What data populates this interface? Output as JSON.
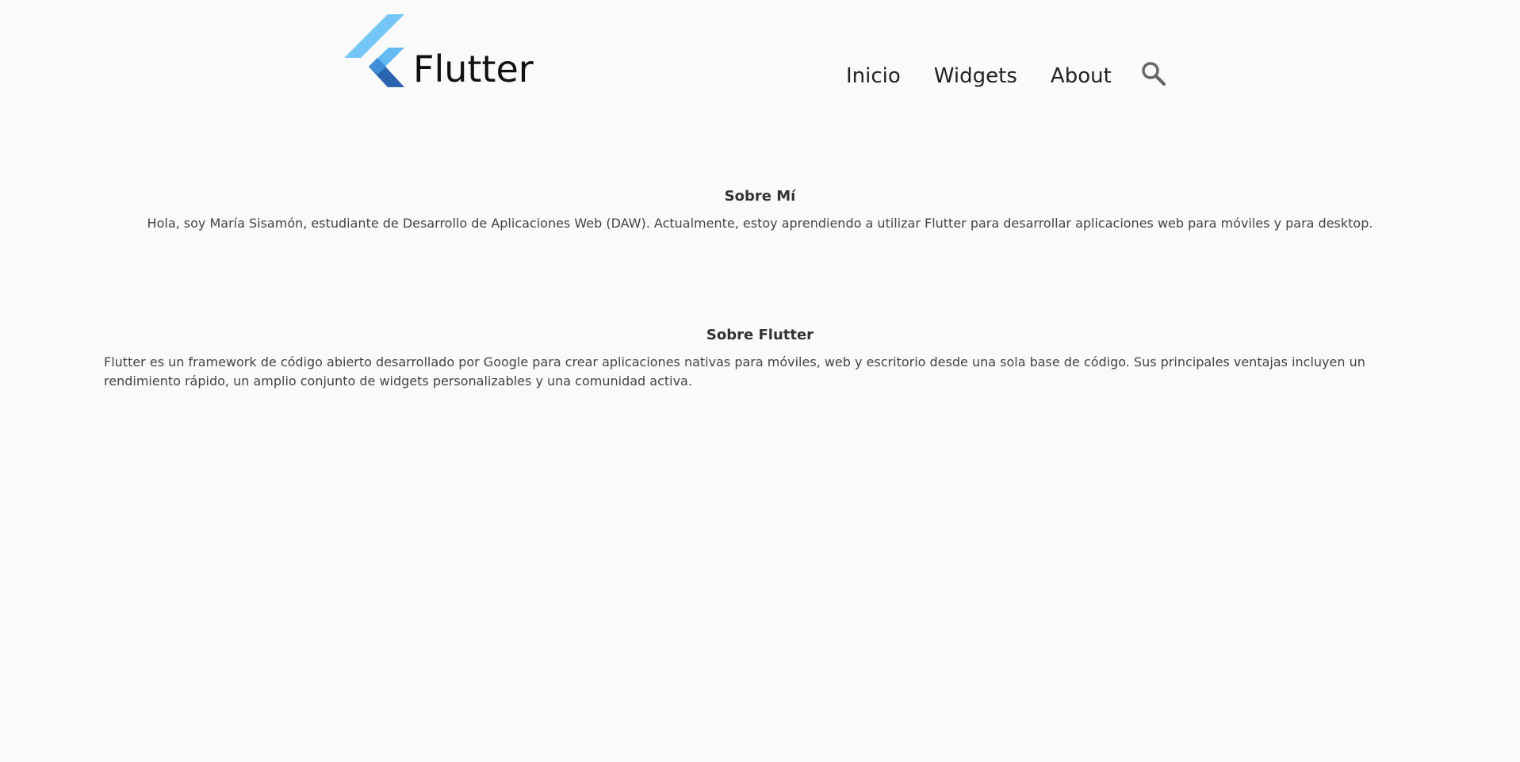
{
  "header": {
    "brand_name": "Flutter",
    "logo_icon": "flutter-logo-icon",
    "nav": {
      "items": [
        {
          "label": "Inicio"
        },
        {
          "label": "Widgets"
        },
        {
          "label": "About"
        }
      ]
    },
    "search_icon": "search-icon"
  },
  "sections": {
    "about_me": {
      "title": "Sobre Mí",
      "text": "Hola, soy María Sisamón, estudiante de Desarrollo de Aplicaciones Web (DAW). Actualmente, estoy aprendiendo a utilizar Flutter para desarrollar aplicaciones web para móviles y para desktop."
    },
    "about_flutter": {
      "title": "Sobre Flutter",
      "text": "Flutter es un framework de código abierto desarrollado por Google para crear aplicaciones nativas para móviles, web y escritorio desde una sola base de código. Sus principales ventajas incluyen un rendimiento rápido, un amplio conjunto de widgets personalizables y una comunidad activa."
    }
  },
  "colors": {
    "background": "#fafafa",
    "logo_light": "#6cc4f7",
    "logo_mid": "#54b3ee",
    "logo_dark": "#1e5aa7",
    "text": "#333333"
  }
}
